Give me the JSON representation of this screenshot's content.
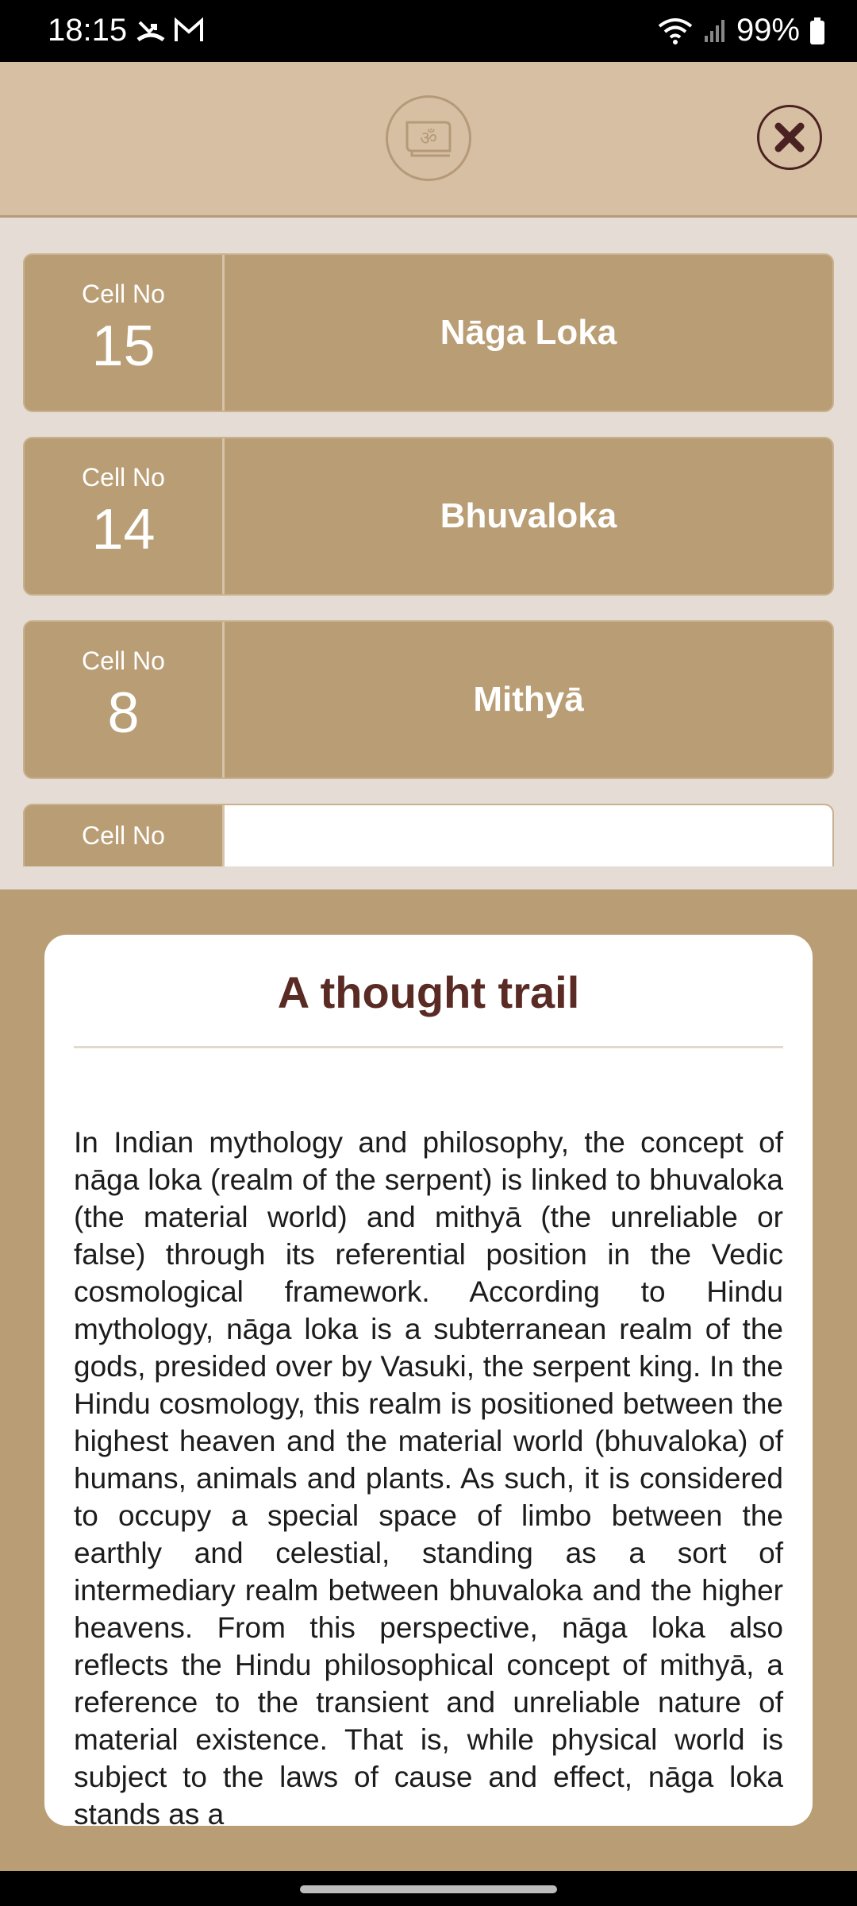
{
  "status_bar": {
    "time": "18:15",
    "battery": "99%",
    "icons": [
      "missed-call-icon",
      "gmail-icon",
      "wifi-icon",
      "signal-icon",
      "battery-icon"
    ]
  },
  "header": {
    "logo_icon": "om-book-icon",
    "close_icon": "close-icon"
  },
  "cells": [
    {
      "label": "Cell No",
      "number": "15",
      "name": "Nāga Loka"
    },
    {
      "label": "Cell No",
      "number": "14",
      "name": "Bhuvaloka"
    },
    {
      "label": "Cell No",
      "number": "8",
      "name": "Mithyā"
    },
    {
      "label": "Cell No",
      "number": "",
      "name": ""
    }
  ],
  "card": {
    "title": "A thought trail",
    "body": "In Indian mythology and philosophy, the concept of nāga loka (realm of the serpent) is linked to bhuvaloka (the material world) and mithyā (the unreliable or false) through its referential position in the Vedic cosmological framework. According to Hindu mythology, nāga loka is a subterranean realm of the gods, presided over by Vasuki, the serpent king. In the Hindu cosmology, this realm is positioned between the highest heaven and the material world (bhuvaloka) of humans, animals and plants. As such, it is considered to occupy a special space of limbo between the earthly and celestial, standing as a sort of intermediary realm between bhuvaloka and the higher heavens. From this perspective, nāga loka also reflects the Hindu philosophical concept of mithyā, a reference to the transient and unreliable nature of material existence. That is, while physical world is subject to the laws of cause and effect, nāga loka stands as a"
  },
  "colors": {
    "header_bg": "#d7bfa3",
    "cell_bg": "#b99d74",
    "title_color": "#5a2a24",
    "close_color": "#4a2222"
  }
}
